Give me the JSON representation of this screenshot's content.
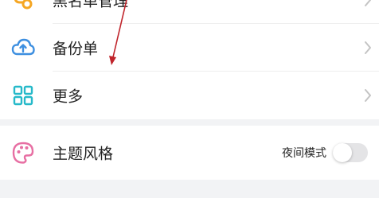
{
  "menu": {
    "items": [
      {
        "label": "黑名单管理",
        "icon": "blacklist-icon"
      },
      {
        "label": "备份单",
        "icon": "cloud-upload-icon"
      },
      {
        "label": "更多",
        "icon": "grid-icon"
      }
    ]
  },
  "theme": {
    "label": "主题风格",
    "icon": "palette-icon",
    "night_mode_label": "夜间模式",
    "night_mode_on": false
  },
  "colors": {
    "cloud_icon": "#3d8fe0",
    "grid_icon": "#26b9c9",
    "palette_icon": "#e76fa3",
    "blacklist_icon": "#f5a623",
    "annotation_arrow": "#c0242b"
  }
}
